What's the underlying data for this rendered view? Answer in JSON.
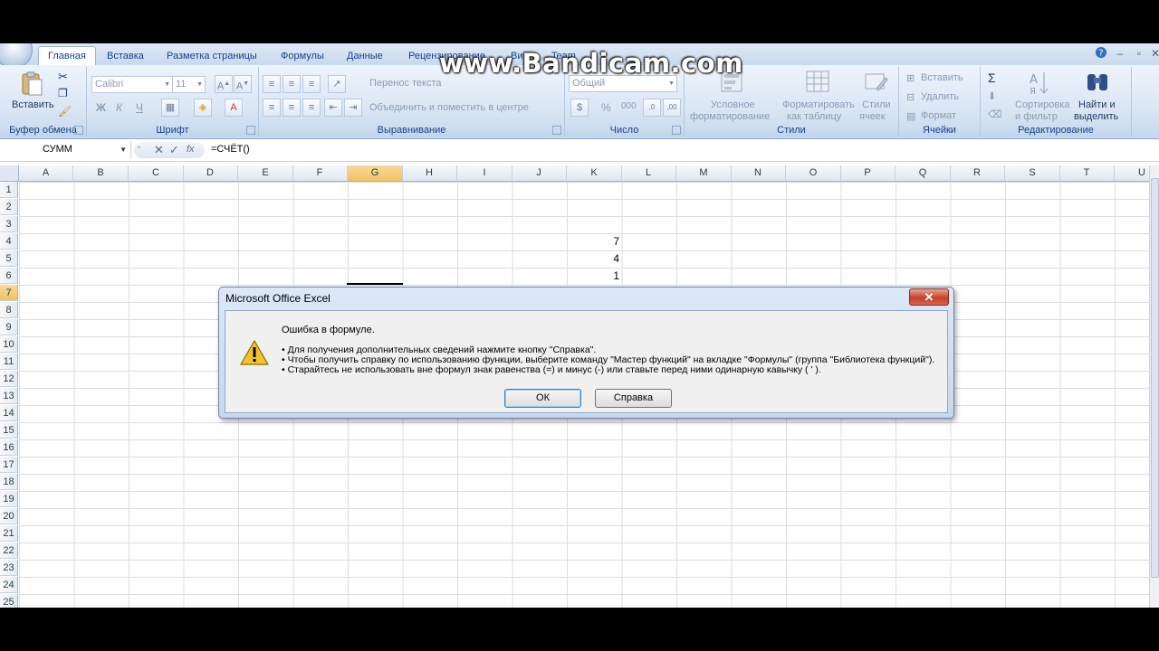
{
  "tabs": [
    "Главная",
    "Вставка",
    "Разметка страницы",
    "Формулы",
    "Данные",
    "Рецензирование",
    "Ви",
    "Team"
  ],
  "ribbon": {
    "clipboard": {
      "paste_label": "Вставить",
      "group_label": "Буфер обмена"
    },
    "font": {
      "font_name": "Calibri",
      "font_size": "11",
      "bold": "Ж",
      "italic": "К",
      "underline": "Ч",
      "group_label": "Шрифт"
    },
    "alignment": {
      "wrap_text": "Перенос текста",
      "merge_center": "Объединить и поместить в центре",
      "group_label": "Выравнивание"
    },
    "number": {
      "format": "Общий",
      "percent": "%",
      "comma": "000",
      "group_label": "Число"
    },
    "styles": {
      "conditional_1": "Условное",
      "conditional_2": "форматирование",
      "table_1": "Форматировать",
      "table_2": "как таблицу",
      "cell_1": "Стили",
      "cell_2": "ячеек",
      "group_label": "Стили"
    },
    "cells": {
      "insert": "Вставить",
      "delete": "Удалить",
      "format": "Формат",
      "group_label": "Ячейки"
    },
    "editing": {
      "sum": "Σ",
      "sort_1": "Сортировка",
      "sort_2": "и фильтр",
      "find_1": "Найти и",
      "find_2": "выделить",
      "group_label": "Редактирование"
    }
  },
  "formula_bar": {
    "name_box": "СУММ",
    "formula": "=СЧЁТ()",
    "fx": "fx"
  },
  "columns": [
    "A",
    "B",
    "C",
    "D",
    "E",
    "F",
    "G",
    "H",
    "I",
    "J",
    "K",
    "L",
    "M",
    "N",
    "O",
    "P",
    "Q",
    "R",
    "S",
    "T",
    "U"
  ],
  "rows": [
    "1",
    "2",
    "3",
    "4",
    "5",
    "6",
    "7",
    "8",
    "9",
    "10",
    "11",
    "12",
    "13",
    "14",
    "15",
    "16",
    "17",
    "18",
    "19",
    "20",
    "21",
    "22",
    "23",
    "24",
    "25"
  ],
  "cell_values": {
    "k4": "7",
    "k5": "4",
    "k6": "1"
  },
  "dialog": {
    "title": "Microsoft Office Excel",
    "close": "✕",
    "message_title": "Ошибка в формуле.",
    "bullets": [
      "• Для получения дополнительных сведений нажмите кнопку \"Справка\".",
      "• Чтобы получить справку по использованию функции, выберите команду \"Мастер функций\" на вкладке \"Формулы\" (группа \"Библиотека функций\").",
      "• Старайтесь не использовать вне формул знак равенства (=) и минус (-) или ставьте перед ними одинарную кавычку ( ' )."
    ],
    "ok": "ОК",
    "help": "Справка"
  },
  "watermark": "www.Bandicam.com"
}
